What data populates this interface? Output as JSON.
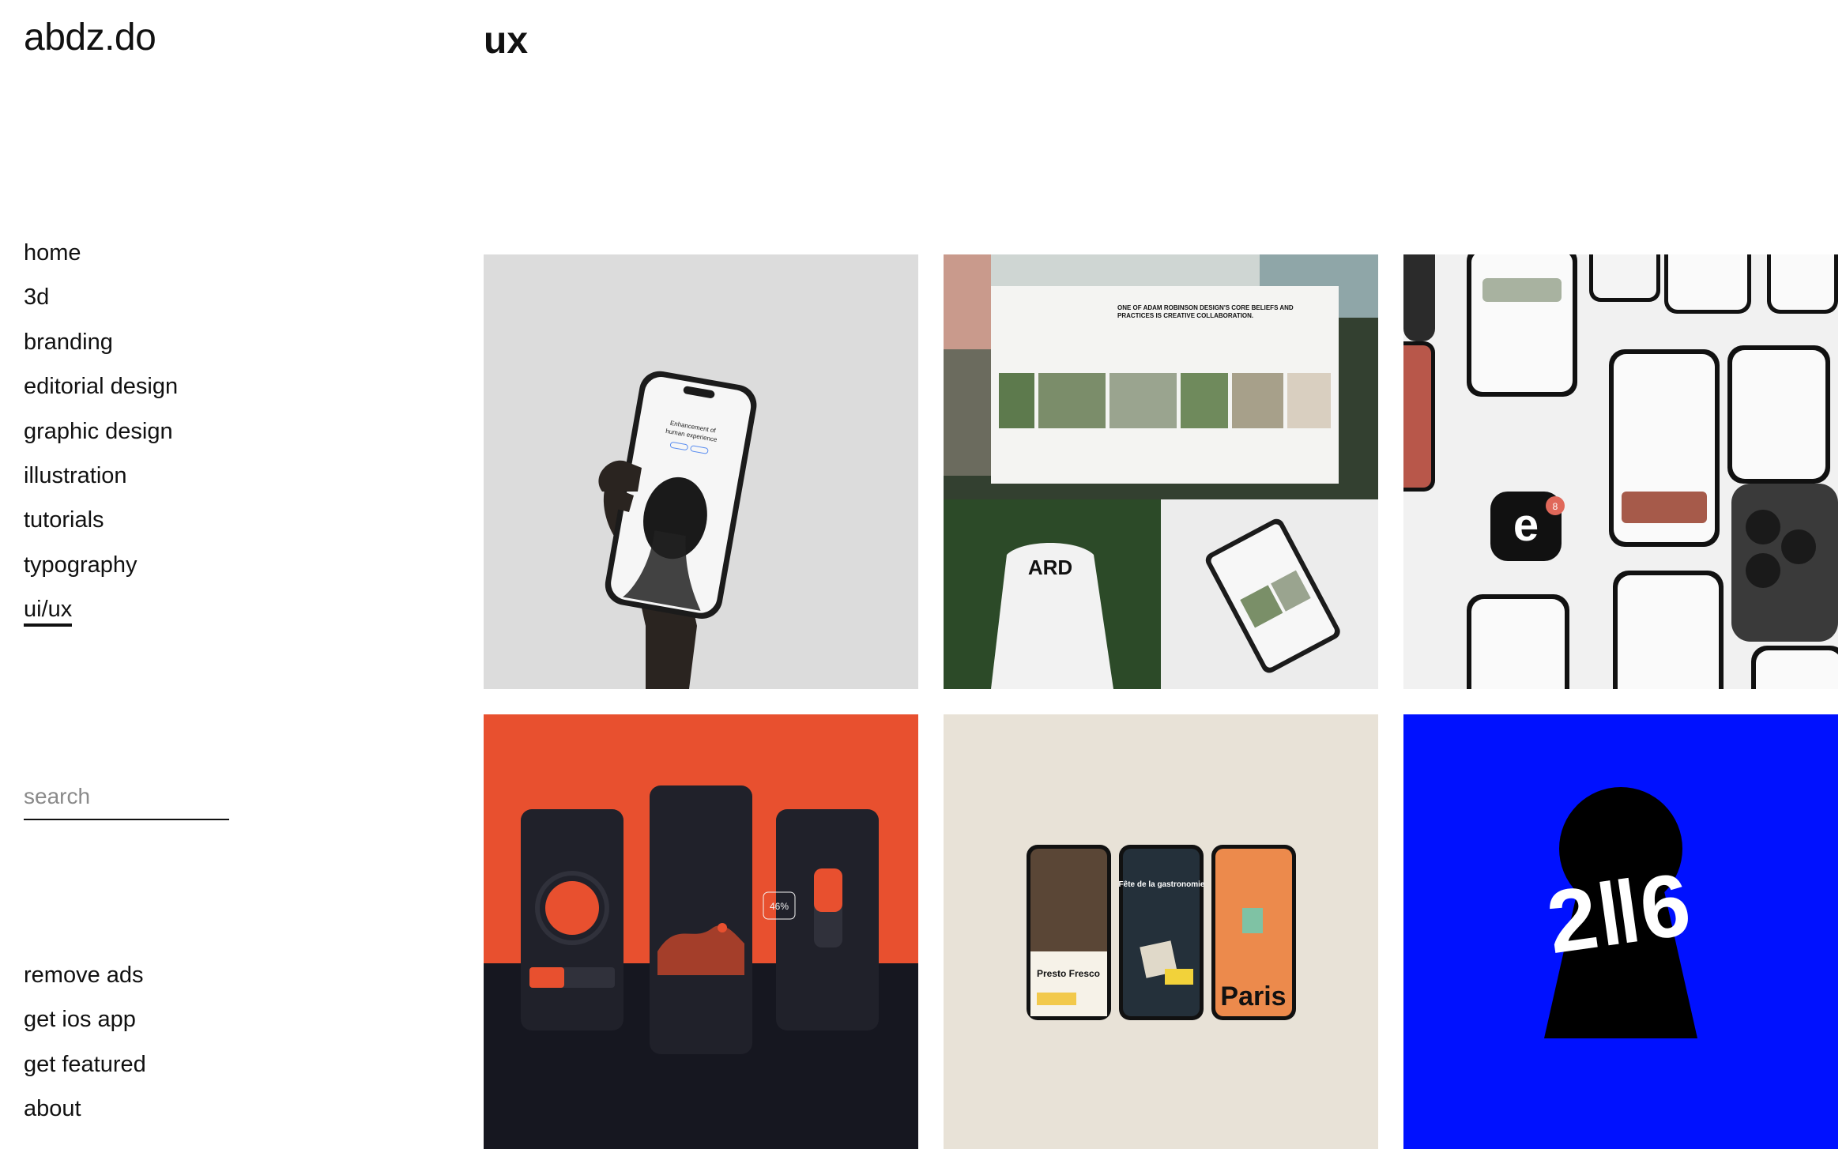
{
  "site": {
    "logo": "abdz.do"
  },
  "page": {
    "title": "ux"
  },
  "nav": {
    "items": [
      {
        "label": "home"
      },
      {
        "label": "3d"
      },
      {
        "label": "branding"
      },
      {
        "label": "editorial design"
      },
      {
        "label": "graphic design"
      },
      {
        "label": "illustration"
      },
      {
        "label": "tutorials"
      },
      {
        "label": "typography"
      },
      {
        "label": "ui/ux",
        "active": true
      }
    ]
  },
  "search": {
    "placeholder": "search",
    "value": ""
  },
  "footer": {
    "links": [
      {
        "label": "remove ads"
      },
      {
        "label": "get ios app"
      },
      {
        "label": "get featured"
      },
      {
        "label": "about"
      }
    ]
  },
  "tiles": [
    {
      "kind": "phone-in-hand",
      "bg": "#dcdcdc",
      "screen_lines": [
        "Enhancement of",
        "human experience"
      ]
    },
    {
      "kind": "collaborations-mockup",
      "bg": "#2f3b2a",
      "heading": "ONE OF ADAM ROBINSON DESIGN'S CORE BELIEFS AND PRACTICES IS CREATIVE COLLABORATION.",
      "shirt_text": "ARD"
    },
    {
      "kind": "app-screens-grid",
      "bg": "#f1f1f1",
      "app_letter": "e",
      "badge": "8"
    },
    {
      "kind": "smart-home-ui",
      "bg": "#e8502f",
      "accent": "#e8502f",
      "percent": "46%"
    },
    {
      "kind": "restaurant-phones",
      "bg": "#e8e2d7",
      "phones": [
        "Presto Fresco",
        "Fête de la gastronomie",
        "Paris"
      ]
    },
    {
      "kind": "keyhole-logo",
      "bg": "#0011ff",
      "number": "2‖6"
    }
  ]
}
